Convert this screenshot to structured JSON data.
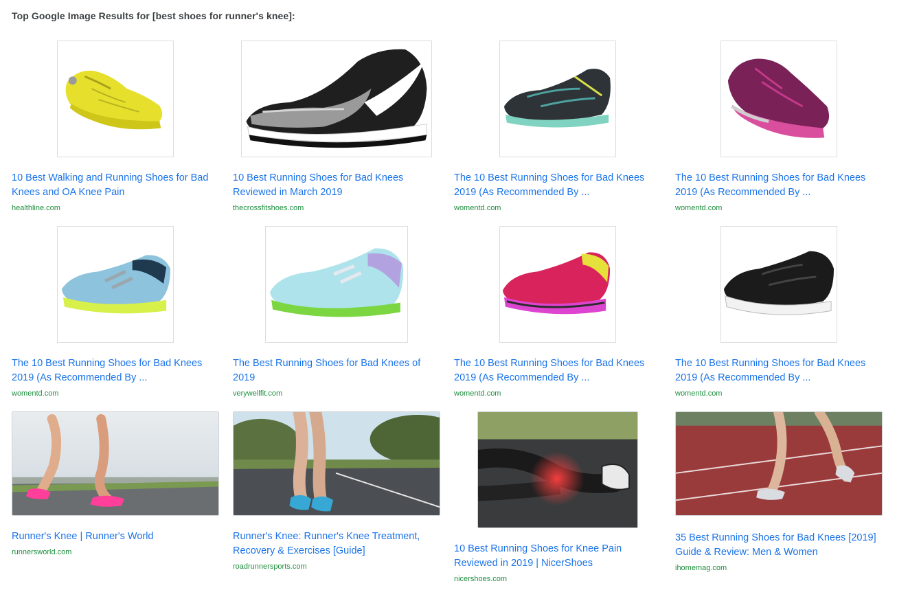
{
  "heading": "Top Google Image Results for [best shoes for runner's knee]:",
  "colors": {
    "link": "#1a73e8",
    "domain": "#1e8e3e",
    "heading": "#3c4043",
    "border": "#dadce0"
  },
  "results": [
    {
      "title": "10 Best Walking and Running Shoes for Bad Knees and OA Knee Pain",
      "domain": "healthline.com",
      "image": "yellow-running-shoe"
    },
    {
      "title": "10 Best Running Shoes for Bad Knees Reviewed in March 2019",
      "domain": "thecrossfitshoes.com",
      "image": "black-white-knit-running-shoe"
    },
    {
      "title": "The 10 Best Running Shoes for Bad Knees 2019 (As Recommended By ...",
      "domain": "womentd.com",
      "image": "black-mint-running-shoe"
    },
    {
      "title": "The 10 Best Running Shoes for Bad Knees 2019 (As Recommended By ...",
      "domain": "womentd.com",
      "image": "purple-running-shoe"
    },
    {
      "title": "The 10 Best Running Shoes for Bad Knees 2019 (As Recommended By ...",
      "domain": "womentd.com",
      "image": "light-blue-running-shoe"
    },
    {
      "title": "The Best Running Shoes for Bad Knees of 2019",
      "domain": "verywellfit.com",
      "image": "aqua-running-shoe"
    },
    {
      "title": "The 10 Best Running Shoes for Bad Knees 2019 (As Recommended By ...",
      "domain": "womentd.com",
      "image": "pink-red-running-shoe"
    },
    {
      "title": "The 10 Best Running Shoes for Bad Knees 2019 (As Recommended By ...",
      "domain": "womentd.com",
      "image": "black-running-shoe"
    },
    {
      "title": "Runner's Knee | Runner's World",
      "domain": "runnersworld.com",
      "image": "runner-legs-pink-shoes-photo"
    },
    {
      "title": "Runner's Knee: Runner's Knee Treatment, Recovery & Exercises [Guide]",
      "domain": "roadrunnersports.com",
      "image": "runner-holding-knee-photo"
    },
    {
      "title": "10 Best Running Shoes for Knee Pain Reviewed in 2019 | NicerShoes",
      "domain": "nicershoes.com",
      "image": "knee-pain-glow-photo"
    },
    {
      "title": "35 Best Running Shoes for Bad Knees [2019] Guide & Review: Men & Women",
      "domain": "ihomemag.com",
      "image": "runner-on-track-photo"
    }
  ]
}
